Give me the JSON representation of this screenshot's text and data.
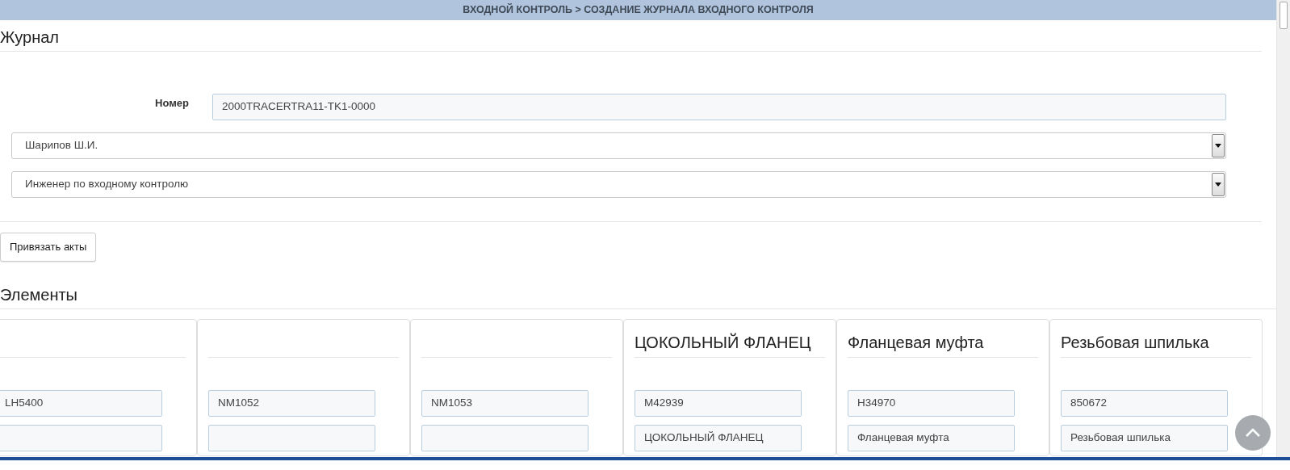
{
  "header": {
    "title": "ВХОДНОЙ КОНТРОЛЬ > СОЗДАНИЕ ЖУРНАЛА ВХОДНОГО КОНТРОЛЯ"
  },
  "journal": {
    "heading": "Журнал",
    "number_label": "Номер",
    "number_value": "2000TRACERTRA11-TK1-0000",
    "selects": [
      {
        "value": "Шарипов Ш.И."
      },
      {
        "value": "Инженер по входному контролю"
      }
    ],
    "button": "Привязать акты"
  },
  "elements": {
    "heading": "Элементы",
    "cards": [
      {
        "code": "LH5400"
      },
      {
        "code": "NM1052"
      },
      {
        "code": "NM1053"
      },
      {
        "title": "ЦОКОЛЬНЫЙ ФЛАНЕЦ",
        "code": "M42939",
        "name": "ЦОКОЛЬНЫЙ ФЛАНЕЦ"
      },
      {
        "title": "Фланцевая муфта",
        "code": "H34970",
        "name": "Фланцевая муфта"
      },
      {
        "title": "Резьбовая шпилька",
        "code": "850672",
        "name": "Резьбовая шпилька"
      }
    ]
  }
}
